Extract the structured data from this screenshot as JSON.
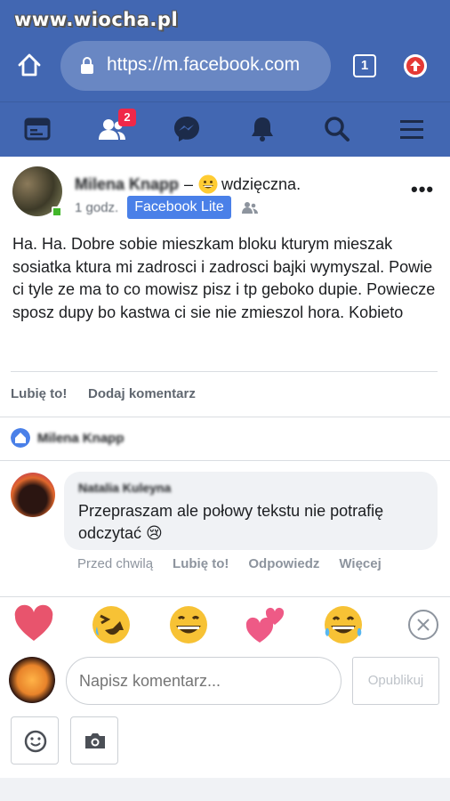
{
  "watermark": "www.wiocha.pl",
  "browser": {
    "url": "https://m.facebook.com",
    "tab_count": "1"
  },
  "nav": {
    "friends_badge": "2",
    "icons": [
      "news-feed-icon",
      "friends-icon",
      "messenger-icon",
      "notifications-icon",
      "search-icon",
      "menu-icon"
    ]
  },
  "post": {
    "author": "Milena Knapp",
    "separator": "–",
    "feeling": "wdzięczna.",
    "time": "1 godz.",
    "app_badge": "Facebook Lite",
    "body": "Ha. Ha. Dobre sobie mieszkam bloku kturym mieszak sosiatka ktura mi zadrosci i zadrosci bajki wymyszal. Powie ci tyle ze ma to co mowisz pisz i tp geboko dupie. Powiecze sposz dupy bo kastwa ci sie nie zmieszol hora. Kobieto",
    "like_label": "Lubię to!",
    "comment_label": "Dodaj komentarz"
  },
  "page_like": {
    "name": "Milena Knapp"
  },
  "comment": {
    "author": "Natalia Kuleyna",
    "text": "Przepraszam ale połowy tekstu nie potrafię odczytać 😢",
    "time": "Przed chwilą",
    "like": "Lubię to!",
    "reply": "Odpowiedz",
    "more": "Więcej"
  },
  "composer": {
    "placeholder": "Napisz komentarz...",
    "publish_label": "Opublikuj"
  },
  "colors": {
    "brand": "#4267b2",
    "lite_badge": "#4a80e8",
    "badge_red": "#f02849"
  }
}
